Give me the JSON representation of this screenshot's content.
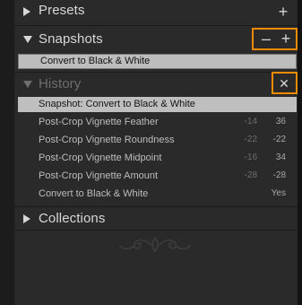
{
  "panels": {
    "presets": {
      "title": "Presets",
      "add_glyph": "+"
    },
    "snapshots": {
      "title": "Snapshots",
      "remove_glyph": "–",
      "add_glyph": "+",
      "items": [
        {
          "label": "Convert to Black & White"
        }
      ]
    },
    "history": {
      "title": "History",
      "clear_glyph": "✕",
      "items": [
        {
          "label": "Snapshot: Convert to Black & White",
          "v1": "",
          "v2": ""
        },
        {
          "label": "Post-Crop Vignette Feather",
          "v1": "-14",
          "v2": "36"
        },
        {
          "label": "Post-Crop Vignette Roundness",
          "v1": "-22",
          "v2": "-22"
        },
        {
          "label": "Post-Crop Vignette Midpoint",
          "v1": "-16",
          "v2": "34"
        },
        {
          "label": "Post-Crop Vignette Amount",
          "v1": "-28",
          "v2": "-28"
        },
        {
          "label": "Convert to Black & White",
          "v1": "",
          "v2": "Yes"
        }
      ]
    },
    "collections": {
      "title": "Collections",
      "add_glyph": "+"
    }
  },
  "colors": {
    "panel_bg": "#2a2a2a",
    "highlight_orange": "#f08a00",
    "selected_row": "#bfbfbf"
  },
  "icons": {
    "collapsed": "triangle-right-icon",
    "expanded": "triangle-down-icon",
    "ornament": "ornament-icon"
  }
}
